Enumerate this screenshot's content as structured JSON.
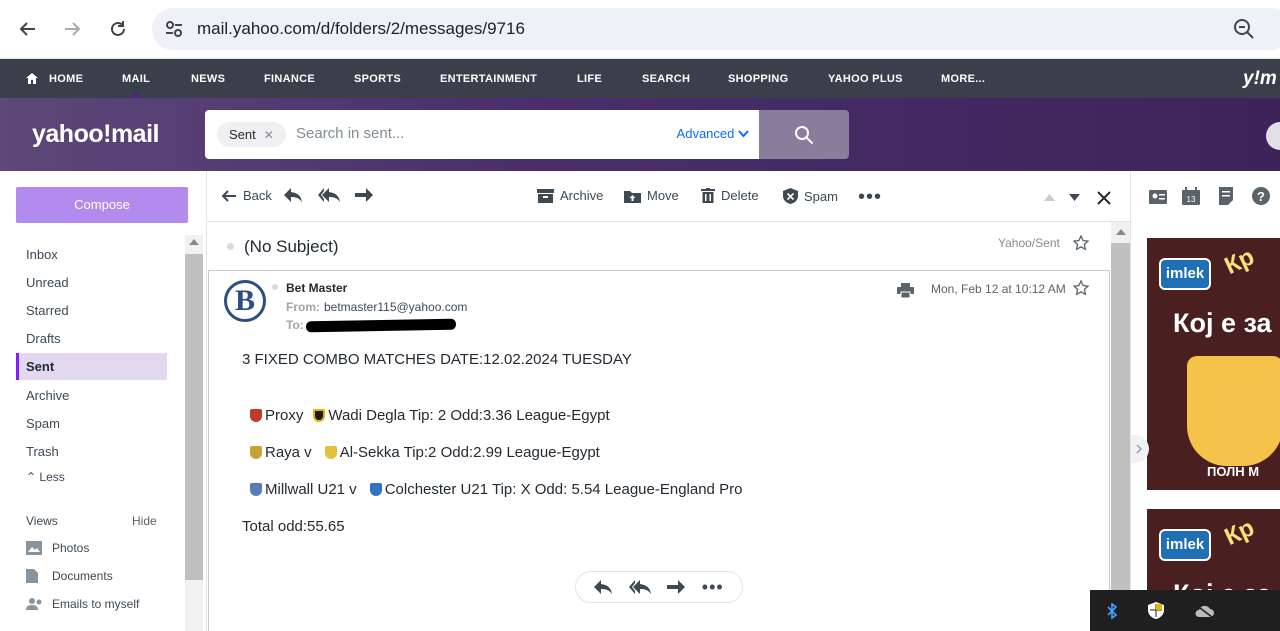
{
  "browser": {
    "url": "mail.yahoo.com/d/folders/2/messages/9716"
  },
  "yahoo_nav": {
    "items": [
      "HOME",
      "MAIL",
      "NEWS",
      "FINANCE",
      "SPORTS",
      "ENTERTAINMENT",
      "LIFE",
      "SEARCH",
      "SHOPPING",
      "YAHOO PLUS",
      "MORE..."
    ],
    "active": "MAIL",
    "logo_mini": "y!m"
  },
  "header": {
    "logo": "yahoo!mail",
    "search_chip": "Sent",
    "search_placeholder": "Search in sent...",
    "advanced_label": "Advanced"
  },
  "sidebar": {
    "compose_label": "Compose",
    "folders": [
      "Inbox",
      "Unread",
      "Starred",
      "Drafts",
      "Sent",
      "Archive",
      "Spam",
      "Trash"
    ],
    "active_folder": "Sent",
    "less_label": "Less",
    "views_label": "Views",
    "hide_label": "Hide",
    "views": [
      "Photos",
      "Documents",
      "Emails to myself"
    ]
  },
  "toolbar": {
    "back": "Back",
    "archive": "Archive",
    "move": "Move",
    "delete": "Delete",
    "spam": "Spam"
  },
  "message": {
    "subject": "(No Subject)",
    "folder_path": "Yahoo/Sent",
    "sender_initial": "B",
    "sender_name": "Bet Master",
    "from_label": "From:",
    "from_email": "betmaster115@yahoo.com",
    "to_label": "To:",
    "date": "Mon, Feb 12 at 10:12 AM",
    "body": {
      "headline": "3 FIXED COMBO MATCHES DATE:12.02.2024 TUESDAY",
      "matches": [
        {
          "home": "Proxy",
          "away": "Wadi Degla Tip: 2 Odd:3.36 League-Egypt",
          "home_color": "#c0392b",
          "away_color": "#1a1a1a"
        },
        {
          "home": "Raya v",
          "away": "Al-Sekka Tip:2 Odd:2.99 League-Egypt",
          "home_color": "#c7a13a",
          "away_color": "#e2c23a"
        },
        {
          "home": "Millwall U21 v",
          "away": "Colchester U21 Tip: X Odd: 5.54 League-England Pro",
          "home_color": "#5b7ab8",
          "away_color": "#2f73c2"
        }
      ],
      "total": "Total odd:55.65"
    }
  },
  "ad": {
    "brand": "imlek",
    "slogan": "Кој е за",
    "foot": "ПОЛН М",
    "tag": "Кр"
  }
}
